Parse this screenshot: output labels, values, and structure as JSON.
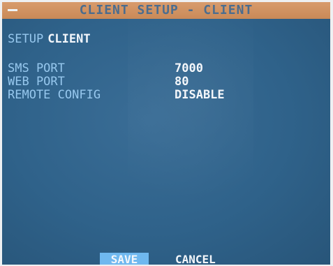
{
  "window": {
    "title": "CLIENT SETUP - CLIENT"
  },
  "section": {
    "prefix": "SETUP",
    "name": "CLIENT"
  },
  "settings": [
    {
      "label": "SMS PORT",
      "value": "7000"
    },
    {
      "label": "WEB PORT",
      "value": "80"
    },
    {
      "label": "REMOTE CONFIG",
      "value": "DISABLE"
    }
  ],
  "actions": {
    "save_label": "SAVE",
    "cancel_label": "CANCEL"
  },
  "colors": {
    "screen_background": "#2f628a",
    "title_bar": "#d89b6c",
    "title_text": "#4a6c8e",
    "label_text": "#97c8ee",
    "value_text": "#f3f6fa",
    "selected_button": "#6fb8ef"
  }
}
